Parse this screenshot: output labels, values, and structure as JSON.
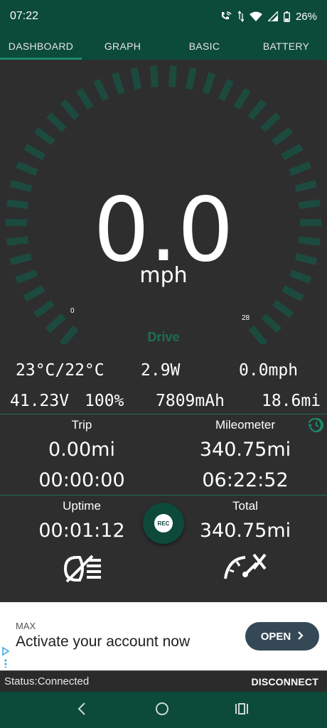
{
  "status_bar": {
    "time": "07:22",
    "battery": "26%"
  },
  "tabs": [
    {
      "label": "DASHBOARD",
      "active": true
    },
    {
      "label": "GRAPH",
      "active": false
    },
    {
      "label": "BASIC",
      "active": false
    },
    {
      "label": "BATTERY",
      "active": false
    }
  ],
  "gauge": {
    "speed": "0.0",
    "unit": "mph",
    "min_label": "0",
    "max_label": "28",
    "mode": "Drive",
    "level_fraction": 0.0
  },
  "stats": {
    "temperature": "23°C/22°C",
    "power": "2.9W",
    "avg_speed": "0.0mph",
    "voltage": "41.23V",
    "battery_pct": "100%",
    "capacity": "7809mAh",
    "range": "18.6mi"
  },
  "trip": {
    "label": "Trip",
    "distance": "0.00mi",
    "time": "00:00:00"
  },
  "mileometer": {
    "label": "Mileometer",
    "distance": "340.75mi",
    "time": "06:22:52"
  },
  "uptime": {
    "label": "Uptime",
    "value": "00:01:12"
  },
  "total": {
    "label": "Total",
    "value": "340.75mi"
  },
  "rec_button": {
    "label": "REC"
  },
  "ad": {
    "sponsor": "MAX",
    "headline": "Activate your account now",
    "cta": "OPEN"
  },
  "connection": {
    "status": "Status:Connected",
    "action": "DISCONNECT"
  },
  "colors": {
    "primary": "#0c4a3a",
    "accent": "#1b8a6b",
    "gauge_track": "#1d4a3e",
    "background": "#2e2e2e"
  },
  "icons": [
    "wifi-calling-icon",
    "data-arrows-icon",
    "wifi-icon",
    "cell-signal-icon",
    "battery-icon",
    "history-icon",
    "headlight-off-icon",
    "speedometer-off-icon",
    "back-icon",
    "home-icon",
    "recents-icon",
    "adchoices-icon",
    "chevron-right-icon"
  ]
}
